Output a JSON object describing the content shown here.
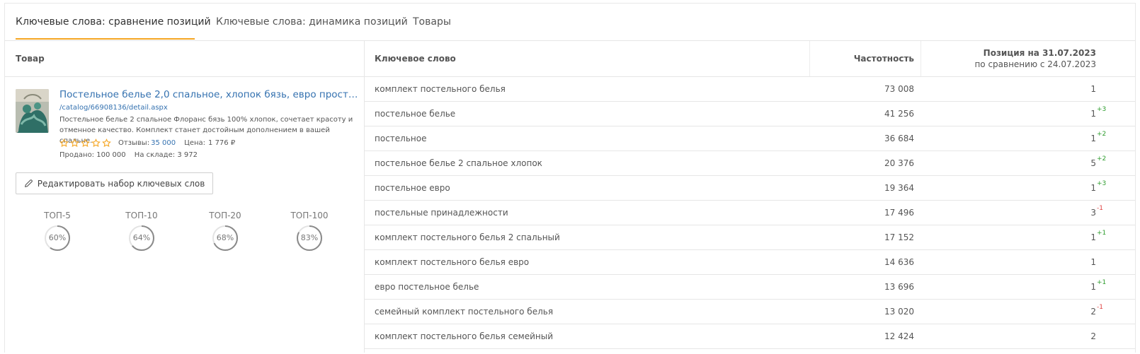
{
  "tabs": [
    {
      "label": "Ключевые слова: сравнение позиций",
      "active": true
    },
    {
      "label": "Ключевые слова: динамика позиций",
      "active": false
    },
    {
      "label": "Товары",
      "active": false
    }
  ],
  "colors": {
    "accent": "#f5a623",
    "link": "#3572b0",
    "up": "#2e9d2e",
    "down": "#e04040"
  },
  "product_column": {
    "header": "Товар"
  },
  "product": {
    "title": "Постельное белье 2,0 спальное, хлопок бязь, евро прост…",
    "url": "/catalog/66908136/detail.aspx",
    "description": "Постельное белье 2 спальное Флоранс бязь 100% хлопок, сочетает красоту и отменное качество. Комплект станет достойным дополнением в вашей спальне.",
    "rating_icon": "star-outline-icon",
    "rating_stars": 0,
    "reviews_label": "Отзывы:",
    "reviews_value": "35 000",
    "price_label": "Цена:",
    "price_value": "1 776 ₽",
    "sold_label": "Продано:",
    "sold_value": "100 000",
    "stock_label": "На складе:",
    "stock_value": "3 972"
  },
  "edit_button": {
    "label": "Редактировать набор ключевых слов",
    "icon": "pencil-icon"
  },
  "top_stats": [
    {
      "label": "ТОП-5",
      "value": "60%",
      "fraction": 0.6
    },
    {
      "label": "ТОП-10",
      "value": "64%",
      "fraction": 0.64
    },
    {
      "label": "ТОП-20",
      "value": "68%",
      "fraction": 0.68
    },
    {
      "label": "ТОП-100",
      "value": "83%",
      "fraction": 0.83
    }
  ],
  "table": {
    "col_keyword": "Ключевое слово",
    "col_frequency": "Частотность",
    "col_position_title": "Позиция на 31.07.2023",
    "col_position_sub": "по сравнению с 24.07.2023",
    "rows": [
      {
        "keyword": "комплект постельного белья",
        "frequency": "73 008",
        "position": "1",
        "delta": ""
      },
      {
        "keyword": "постельное белье",
        "frequency": "41 256",
        "position": "1",
        "delta": "+3"
      },
      {
        "keyword": "постельное",
        "frequency": "36 684",
        "position": "1",
        "delta": "+2"
      },
      {
        "keyword": "постельное белье 2 спальное хлопок",
        "frequency": "20 376",
        "position": "5",
        "delta": "+2"
      },
      {
        "keyword": "постельное евро",
        "frequency": "19 364",
        "position": "1",
        "delta": "+3"
      },
      {
        "keyword": "постельные принадлежности",
        "frequency": "17 496",
        "position": "3",
        "delta": "-1"
      },
      {
        "keyword": "комплект постельного белья 2 спальный",
        "frequency": "17 152",
        "position": "1",
        "delta": "+1"
      },
      {
        "keyword": "комплект постельного белья евро",
        "frequency": "14 636",
        "position": "1",
        "delta": ""
      },
      {
        "keyword": "евро постельное белье",
        "frequency": "13 696",
        "position": "1",
        "delta": "+1"
      },
      {
        "keyword": "семейный комплект постельного белья",
        "frequency": "13 020",
        "position": "2",
        "delta": "-1"
      },
      {
        "keyword": "комплект постельного белья семейный",
        "frequency": "12 424",
        "position": "2",
        "delta": ""
      }
    ]
  }
}
